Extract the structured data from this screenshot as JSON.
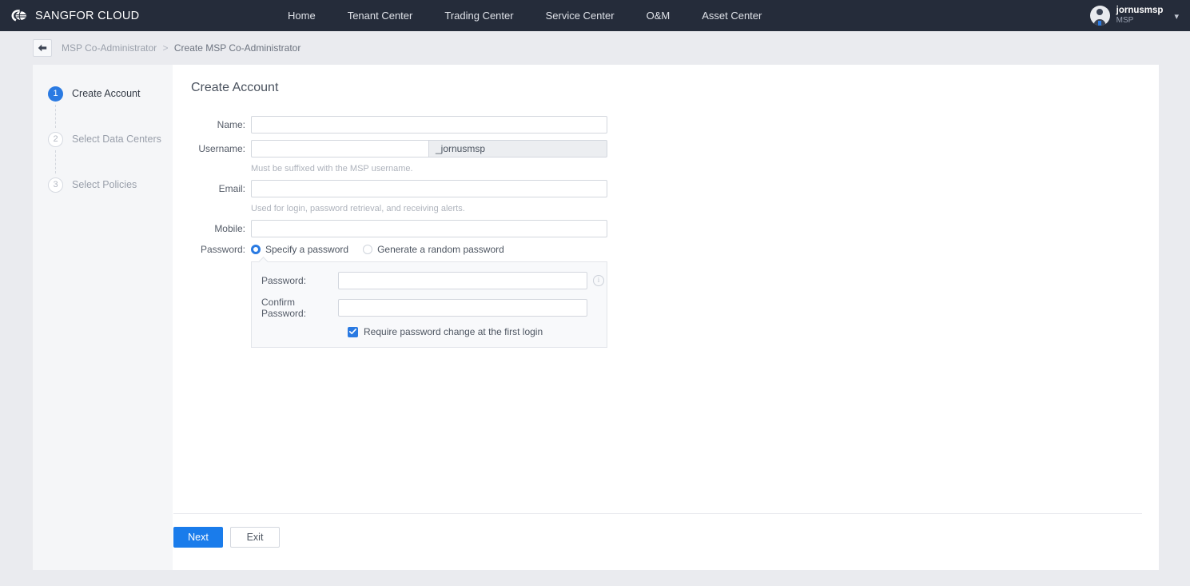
{
  "topbar": {
    "brand": "SANGFOR CLOUD",
    "logo_icon": "cloud-sphere-logo",
    "nav_items": [
      {
        "label": "Home",
        "name": "nav-home"
      },
      {
        "label": "Tenant Center",
        "name": "nav-tenant-center"
      },
      {
        "label": "Trading Center",
        "name": "nav-trading-center"
      },
      {
        "label": "Service Center",
        "name": "nav-service-center"
      },
      {
        "label": "O&M",
        "name": "nav-om"
      },
      {
        "label": "Asset Center",
        "name": "nav-asset-center"
      }
    ],
    "user": {
      "name": "jornusmsp",
      "role": "MSP",
      "avatar_icon": "user-avatar-icon",
      "caret_icon": "chevron-down-icon"
    }
  },
  "breadcrumb": {
    "back_icon": "back-arrow-icon",
    "parent": "MSP Co-Administrator",
    "separator": ">",
    "current": "Create MSP Co-Administrator"
  },
  "steps": [
    {
      "num": "1",
      "label": "Create Account",
      "state": "active"
    },
    {
      "num": "2",
      "label": "Select Data Centers",
      "state": "idle"
    },
    {
      "num": "3",
      "label": "Select Policies",
      "state": "idle"
    }
  ],
  "form": {
    "title": "Create Account",
    "name": {
      "label": "Name:",
      "value": "",
      "placeholder": ""
    },
    "username": {
      "label": "Username:",
      "value": "",
      "placeholder": "",
      "suffix": "_jornusmsp",
      "hint": "Must be suffixed with the MSP username."
    },
    "email": {
      "label": "Email:",
      "value": "",
      "placeholder": "",
      "hint": "Used for login, password retrieval, and receiving alerts."
    },
    "mobile": {
      "label": "Mobile:",
      "value": "",
      "placeholder": ""
    },
    "password": {
      "label": "Password:",
      "options": [
        {
          "label": "Specify a password",
          "selected": true
        },
        {
          "label": "Generate a random password",
          "selected": false
        }
      ],
      "password_label": "Password:",
      "password_value": "",
      "confirm_label": "Confirm Password:",
      "confirm_value": "",
      "info_icon": "info-circle-icon",
      "require_change_label": "Require password change at the first login",
      "require_change_checked": true
    }
  },
  "footer": {
    "next_label": "Next",
    "exit_label": "Exit"
  },
  "colors": {
    "topbar_bg": "#252c3a",
    "page_bg": "#eaebef",
    "accent": "#1a7ceb",
    "step_active": "#2a7ae2",
    "card_bg": "#ffffff",
    "sidebar_bg": "#f5f6f8"
  }
}
